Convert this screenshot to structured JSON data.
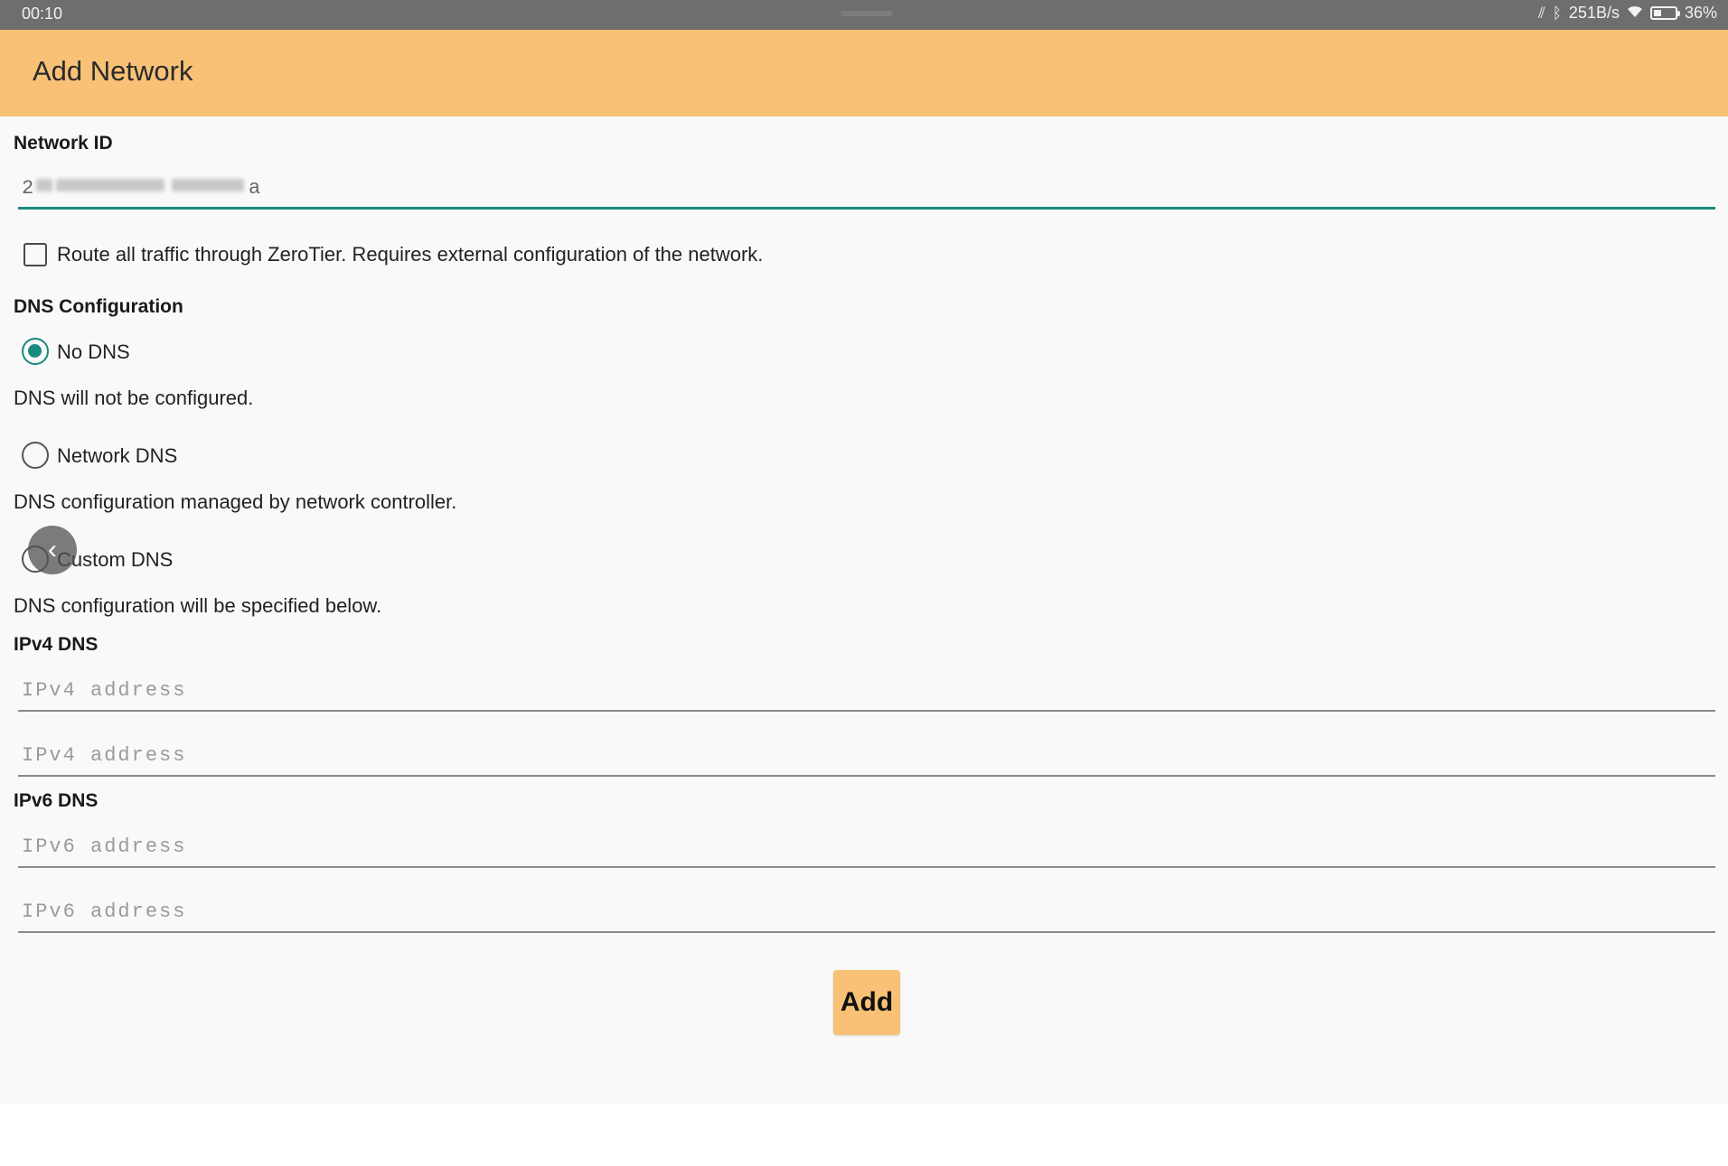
{
  "status_bar": {
    "time": "00:10",
    "net_speed": "251B/s",
    "battery_percent": "36%",
    "battery_level": 0.36,
    "icons": [
      "vibrate-icon",
      "bluetooth-icon",
      "wifi-icon",
      "battery-icon"
    ]
  },
  "app_bar": {
    "title": "Add Network",
    "color": "#f8c176"
  },
  "form": {
    "network_id_label": "Network ID",
    "network_id_value": "2",
    "network_id_value_end": "a",
    "route_all_label": "Route all traffic through ZeroTier. Requires external configuration of the network.",
    "route_all_checked": false,
    "dns_section_label": "DNS Configuration",
    "dns_options": [
      {
        "label": "No DNS",
        "description": "DNS will not be configured.",
        "selected": true
      },
      {
        "label": "Network DNS",
        "description": "DNS configuration managed by network controller.",
        "selected": false
      },
      {
        "label": "Custom DNS",
        "description": "DNS configuration will be specified below.",
        "selected": false
      }
    ],
    "ipv4_label": "IPv4 DNS",
    "ipv4_placeholder": "IPv4 address",
    "ipv6_label": "IPv6 DNS",
    "ipv6_placeholder": "IPv6 address",
    "add_button_label": "Add"
  },
  "colors": {
    "accent": "#1a8a7e",
    "primary": "#f8c176"
  }
}
